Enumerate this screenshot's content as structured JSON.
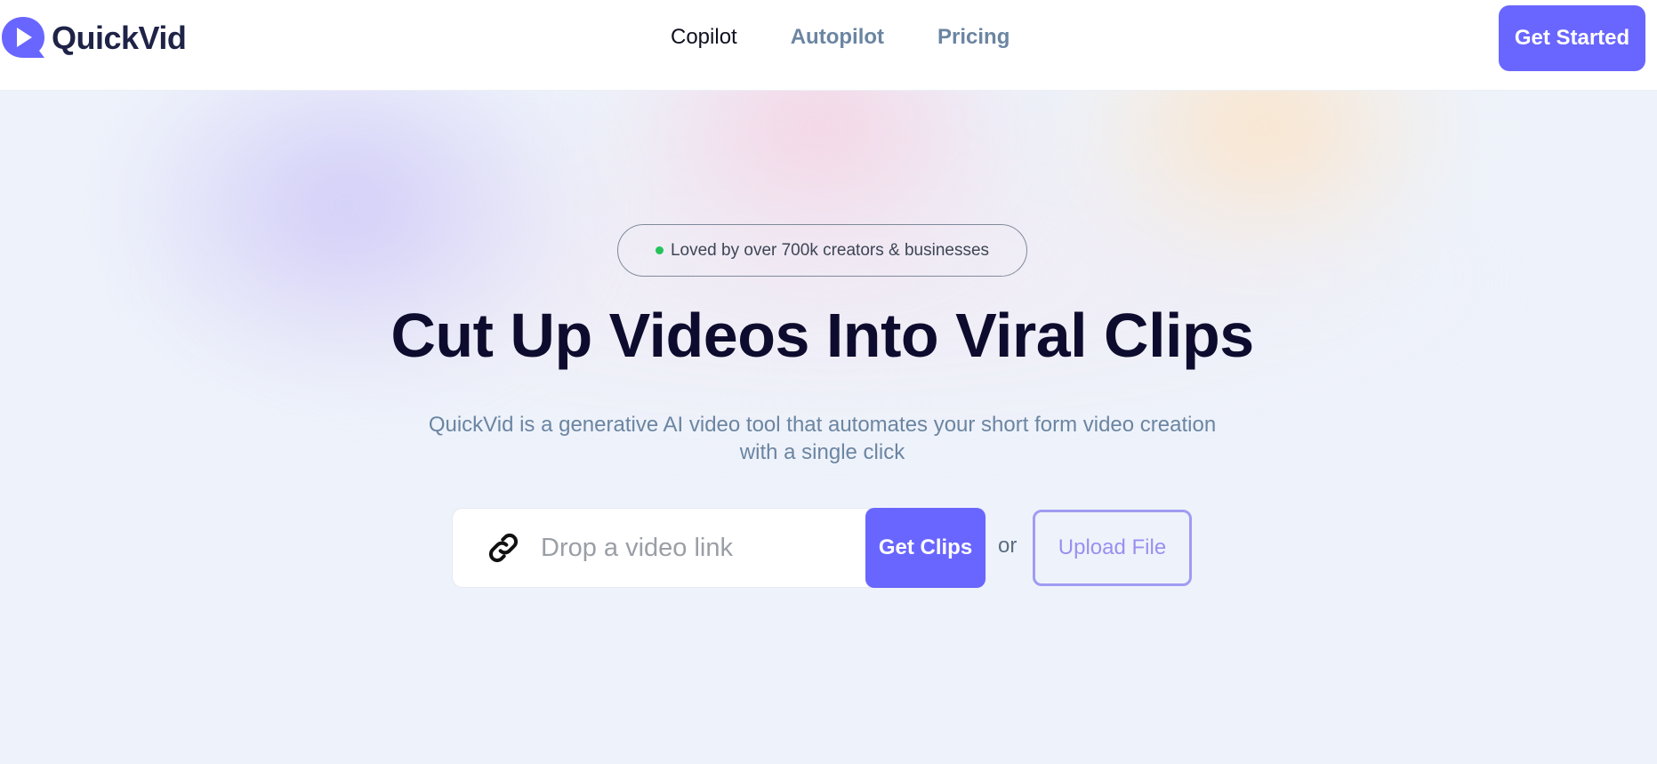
{
  "brand": {
    "name": "QuickVid",
    "logo_icon": "play-speech-bubble-icon",
    "logo_color": "#6966ff"
  },
  "nav": {
    "items": [
      {
        "label": "Copilot",
        "active": true
      },
      {
        "label": "Autopilot",
        "active": false
      },
      {
        "label": "Pricing",
        "active": false
      }
    ]
  },
  "header": {
    "cta_label": "Get Started"
  },
  "hero": {
    "badge_text": "Loved by over 700k creators & businesses",
    "badge_dot_color": "#24c35a",
    "headline": "Cut Up Videos Into Viral Clips",
    "subtitle": "QuickVid is a generative AI video tool that automates your short form video creation with a single click"
  },
  "search": {
    "icon": "link-icon",
    "placeholder": "Drop a video link",
    "value": "",
    "submit_label": "Get Clips"
  },
  "upload": {
    "or_text": "or",
    "label": "Upload File"
  },
  "colors": {
    "accent": "#6966ff",
    "heading": "#0e0c2e",
    "muted": "#6b85a2",
    "upload_border": "#a09cf2"
  }
}
